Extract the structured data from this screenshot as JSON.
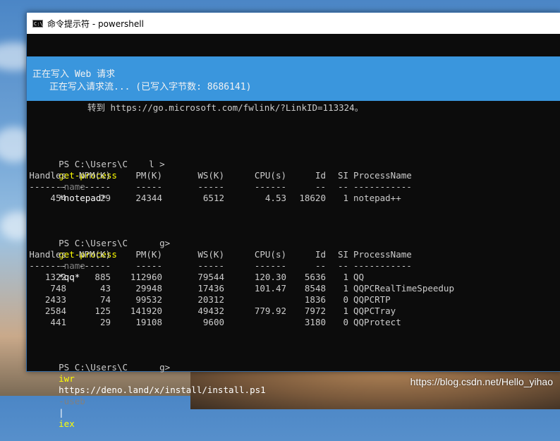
{
  "window": {
    "title": "命令提示符 - powershell",
    "icon_glyph": "C:\\"
  },
  "progress": {
    "line1": "正在写入 Web 请求",
    "line2": "正在写入请求流... (已写入字节数: 8686141)",
    "bg": "#3a96dd"
  },
  "console": {
    "redirect_line": "转到 https://go.microsoft.com/fwlink/?LinkID=113324。",
    "prompt1": {
      "prompt": "PS C:\\Users\\C    l >",
      "cmd": "get-process",
      "param": "-name",
      "arg": "*notepad*"
    },
    "prompt2": {
      "prompt": "PS C:\\Users\\C      g>",
      "cmd": "get-process",
      "param": "-name",
      "arg": "*qq*"
    },
    "prompt3": {
      "prompt": "PS C:\\Users\\C      g>",
      "cmd": "iwr",
      "url": "https://deno.land/x/install/install.ps1",
      "param": "-useb",
      "pipe": "|",
      "cmd2": "iex"
    },
    "headers": [
      "Handles",
      "NPM(K)",
      "PM(K)",
      "WS(K)",
      "CPU(s)",
      "Id",
      "SI",
      "ProcessName"
    ],
    "dashes": [
      "-------",
      "------",
      "-----",
      "-----",
      "------",
      "--",
      "--",
      "-----------"
    ],
    "table1": [
      [
        "454",
        "29",
        "24344",
        "6512",
        "4.53",
        "18620",
        "1",
        "notepad++"
      ]
    ],
    "table2": [
      [
        "1322",
        "885",
        "112960",
        "79544",
        "120.30",
        "5636",
        "1",
        "QQ"
      ],
      [
        "748",
        "43",
        "29948",
        "17436",
        "101.47",
        "8548",
        "1",
        "QQPCRealTimeSpeedup"
      ],
      [
        "2433",
        "74",
        "99532",
        "20312",
        "",
        "1836",
        "0",
        "QQPCRTP"
      ],
      [
        "2584",
        "125",
        "141920",
        "49432",
        "779.92",
        "7972",
        "1",
        "QQPCTray"
      ],
      [
        "441",
        "29",
        "19108",
        "9600",
        "",
        "3180",
        "0",
        "QQProtect"
      ]
    ]
  },
  "watermark": "https://blog.csdn.net/Hello_yihao"
}
